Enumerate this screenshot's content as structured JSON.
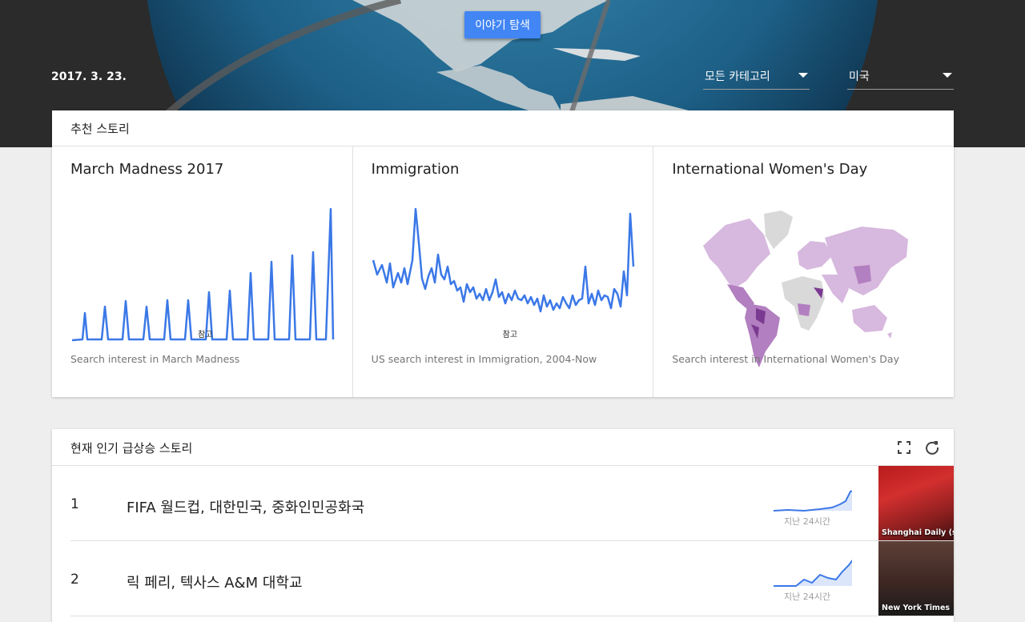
{
  "header": {
    "explore_label": "이야기 탐색",
    "date": "2017. 3. 23.",
    "category": "모든 카테고리",
    "region": "미국"
  },
  "featured": {
    "title": "추천 스토리",
    "stories": [
      {
        "title": "March Madness 2017",
        "caption": "Search interest in March Madness",
        "note": "참고",
        "icon": "line-chart"
      },
      {
        "title": "Immigration",
        "caption": "US search interest in Immigration, 2004-Now",
        "note": "참고",
        "icon": "line-chart"
      },
      {
        "title": "International Women's Day",
        "caption": "Search interest in International Women's Day",
        "icon": "world-map"
      }
    ]
  },
  "trending": {
    "title": "현재 인기 급상승 스토리",
    "items": [
      {
        "rank": "1",
        "title": "FIFA 월드컵, 대한민국, 중화인민공화국",
        "since": "지난 24시간",
        "source": "Shanghai Daily (s..."
      },
      {
        "rank": "2",
        "title": "릭 페리, 텍사스 A&M 대학교",
        "since": "지난 24시간",
        "source": "New York Times"
      }
    ]
  },
  "colors": {
    "accent": "#4285f4",
    "line": "#3b78e7",
    "map_light": "#d7b8de",
    "map_mid": "#b27fc0",
    "map_dark": "#7b3a91"
  }
}
